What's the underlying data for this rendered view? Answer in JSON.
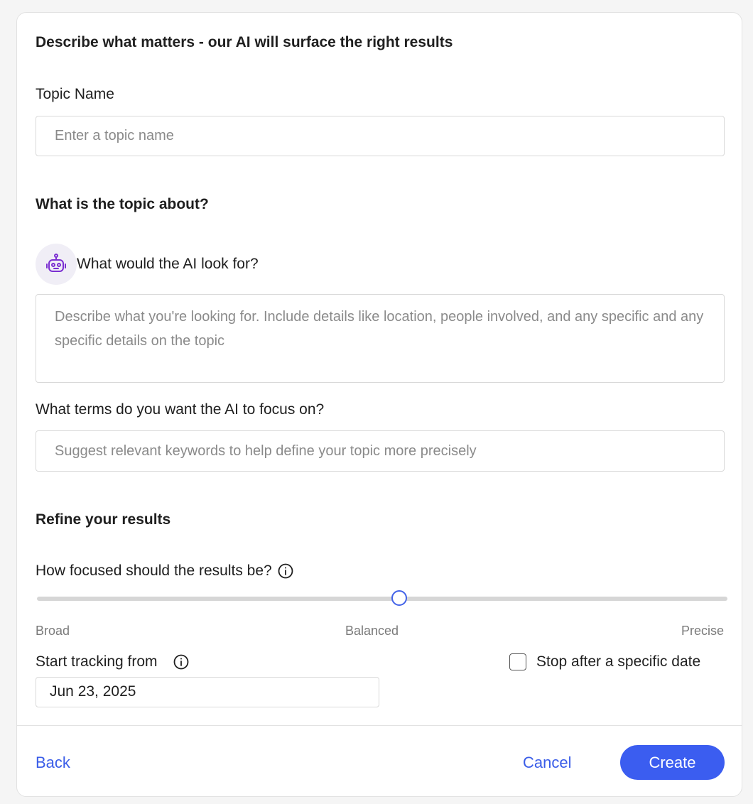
{
  "header": {
    "title": "Describe what matters - our AI will surface the right results"
  },
  "topic_name": {
    "label": "Topic Name",
    "placeholder": "Enter a topic name",
    "value": ""
  },
  "about_section": {
    "title": "What is the topic about?"
  },
  "ai_look_for": {
    "label": "What would the AI look for?",
    "placeholder": "Describe what you're looking for. Include details like location, people involved, and any specific and any specific details on the topic",
    "value": ""
  },
  "ai_terms": {
    "label": "What terms do you want the AI to focus on?",
    "placeholder": "Suggest relevant keywords to help define your topic more precisely",
    "value": ""
  },
  "refine_section": {
    "title": "Refine your results"
  },
  "focus_slider": {
    "label": "How focused should the results be?",
    "ticks": [
      "Broad",
      "Balanced",
      "Precise"
    ],
    "value_fraction": 0.525
  },
  "tracking": {
    "start_label": "Start tracking from",
    "start_date": "Jun 23, 2025",
    "stop_label": "Stop after a specific date",
    "stop_checked": false
  },
  "footer": {
    "back_label": "Back",
    "cancel_label": "Cancel",
    "create_label": "Create"
  },
  "colors": {
    "accent": "#3b5df0",
    "link": "#3a5de8",
    "robot_purple": "#7b2fd1"
  }
}
